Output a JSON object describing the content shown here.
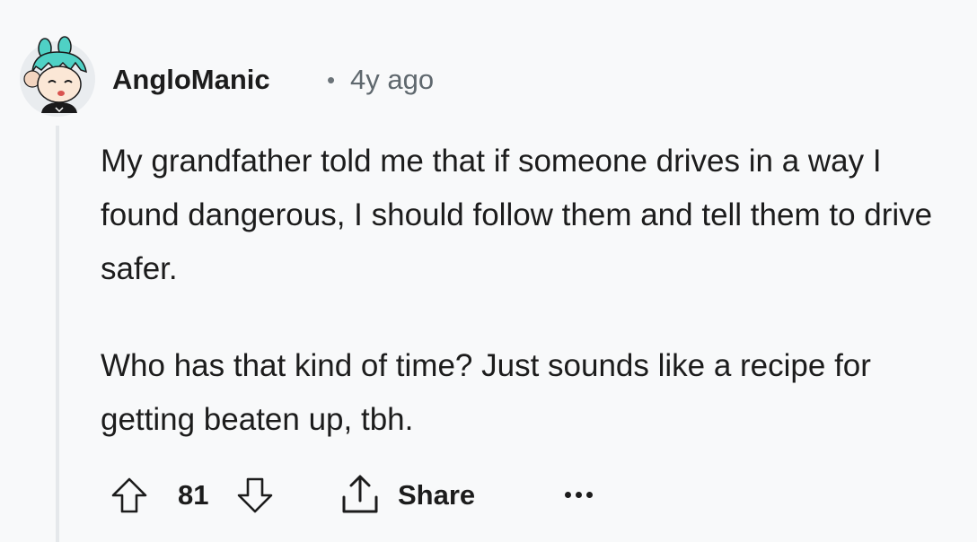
{
  "comment": {
    "author": "AngloManic",
    "separator": "•",
    "timestamp": "4y ago",
    "paragraphs": [
      "My grandfather told me that if someone drives in a way I found dangerous, I should follow them and tell them to drive safer.",
      "Who has that kind of time? Just sounds like a recipe for getting beaten up, tbh."
    ]
  },
  "actions": {
    "score": "81",
    "share_label": "Share",
    "upvote_icon": "arrow-up-icon",
    "downvote_icon": "arrow-down-icon",
    "share_icon": "share-upload-icon",
    "more_icon": "ellipsis-icon"
  },
  "colors": {
    "background": "#f8f9fa",
    "thread_line": "#e5e8eb",
    "text": "#1c1c1c",
    "meta": "#5f686e",
    "avatar_hair": "#4fd1c5"
  }
}
